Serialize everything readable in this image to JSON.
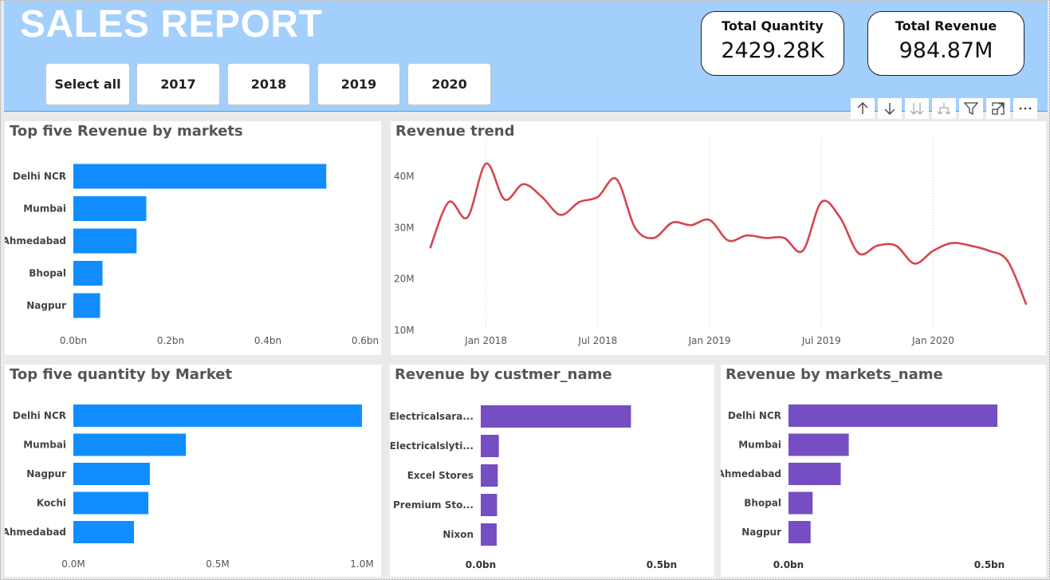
{
  "header": {
    "title": "SALES REPORT",
    "slicer": [
      "Select all",
      "2017",
      "2018",
      "2019",
      "2020"
    ],
    "kpis": [
      {
        "label": "Total Quantity",
        "value": "2429.28K"
      },
      {
        "label": "Total Revenue",
        "value": "984.87M"
      }
    ]
  },
  "toolbar": {
    "icons": [
      "arrow-up-icon",
      "arrow-down-icon",
      "double-down-arrows-icon",
      "expand-hierarchy-icon",
      "filter-icon",
      "focus-mode-icon",
      "more-options-icon"
    ]
  },
  "colors": {
    "blue_bar": "#118dff",
    "purple_bar": "#744ec2",
    "line": "#d64550",
    "header_bg": "#a2cffc"
  },
  "chart_data": [
    {
      "id": "rev_markets",
      "type": "bar",
      "orientation": "horizontal",
      "title": "Top five Revenue by markets",
      "categories": [
        "Delhi NCR",
        "Mumbai",
        "Ahmedabad",
        "Bhopal",
        "Nagpur"
      ],
      "values": [
        0.52,
        0.15,
        0.13,
        0.06,
        0.055
      ],
      "xlim": [
        0,
        0.6
      ],
      "xticks": [
        0,
        0.2,
        0.4,
        0.6
      ],
      "xtick_labels": [
        "0.0bn",
        "0.2bn",
        "0.4bn",
        "0.6bn"
      ],
      "color": "#118dff"
    },
    {
      "id": "rev_trend",
      "type": "line",
      "title": "Revenue trend",
      "x": [
        "2017-10",
        "2017-11",
        "2017-12",
        "2018-01",
        "2018-02",
        "2018-03",
        "2018-04",
        "2018-05",
        "2018-06",
        "2018-07",
        "2018-08",
        "2018-09",
        "2018-10",
        "2018-11",
        "2018-12",
        "2019-01",
        "2019-02",
        "2019-03",
        "2019-04",
        "2019-05",
        "2019-06",
        "2019-07",
        "2019-08",
        "2019-09",
        "2019-10",
        "2019-11",
        "2019-12",
        "2020-01",
        "2020-02",
        "2020-03",
        "2020-04",
        "2020-05",
        "2020-06"
      ],
      "values": [
        26,
        35,
        32,
        42.5,
        35.5,
        38.5,
        36,
        32.5,
        35,
        36,
        39.5,
        30,
        28,
        31,
        30.5,
        31.5,
        27.5,
        28.5,
        28,
        28,
        25.5,
        35,
        32,
        25,
        26.5,
        26.5,
        23,
        25.5,
        27,
        26.5,
        25.5,
        23.5,
        15
      ],
      "ylim": [
        10,
        45
      ],
      "yticks": [
        10,
        20,
        30,
        40
      ],
      "ytick_labels": [
        "10M",
        "20M",
        "30M",
        "40M"
      ],
      "xtick_labels": [
        {
          "at": "2018-01",
          "label": "Jan 2018"
        },
        {
          "at": "2018-07",
          "label": "Jul 2018"
        },
        {
          "at": "2019-01",
          "label": "Jan 2019"
        },
        {
          "at": "2019-07",
          "label": "Jul 2019"
        },
        {
          "at": "2020-01",
          "label": "Jan 2020"
        }
      ],
      "color": "#d64550"
    },
    {
      "id": "qty_market",
      "type": "bar",
      "orientation": "horizontal",
      "title": "Top five quantity by Market",
      "categories": [
        "Delhi NCR",
        "Mumbai",
        "Nagpur",
        "Kochi",
        "Ahmedabad"
      ],
      "values": [
        1.0,
        0.39,
        0.265,
        0.26,
        0.21
      ],
      "xlim": [
        0,
        1.0
      ],
      "xticks": [
        0,
        0.5,
        1.0
      ],
      "xtick_labels": [
        "0.0M",
        "0.5M",
        "1.0M"
      ],
      "color": "#118dff"
    },
    {
      "id": "rev_customer",
      "type": "bar",
      "orientation": "horizontal",
      "title": "Revenue by custmer_name",
      "categories": [
        "Electricalsara...",
        "Electricalslyti...",
        "Excel Stores",
        "Premium Sto...",
        "Nixon"
      ],
      "values": [
        0.415,
        0.05,
        0.047,
        0.045,
        0.044
      ],
      "xlim": [
        0,
        0.5
      ],
      "xticks": [
        0,
        0.5
      ],
      "xtick_labels": [
        "0.0bn",
        "0.5bn"
      ],
      "color": "#744ec2"
    },
    {
      "id": "rev_markets_name",
      "type": "bar",
      "orientation": "horizontal",
      "title": "Revenue by markets_name",
      "categories": [
        "Delhi NCR",
        "Mumbai",
        "Ahmedabad",
        "Bhopal",
        "Nagpur"
      ],
      "values": [
        0.52,
        0.15,
        0.13,
        0.06,
        0.055
      ],
      "xlim": [
        0,
        0.5
      ],
      "xticks": [
        0,
        0.5
      ],
      "xtick_labels": [
        "0.0bn",
        "0.5bn"
      ],
      "color": "#744ec2"
    }
  ]
}
